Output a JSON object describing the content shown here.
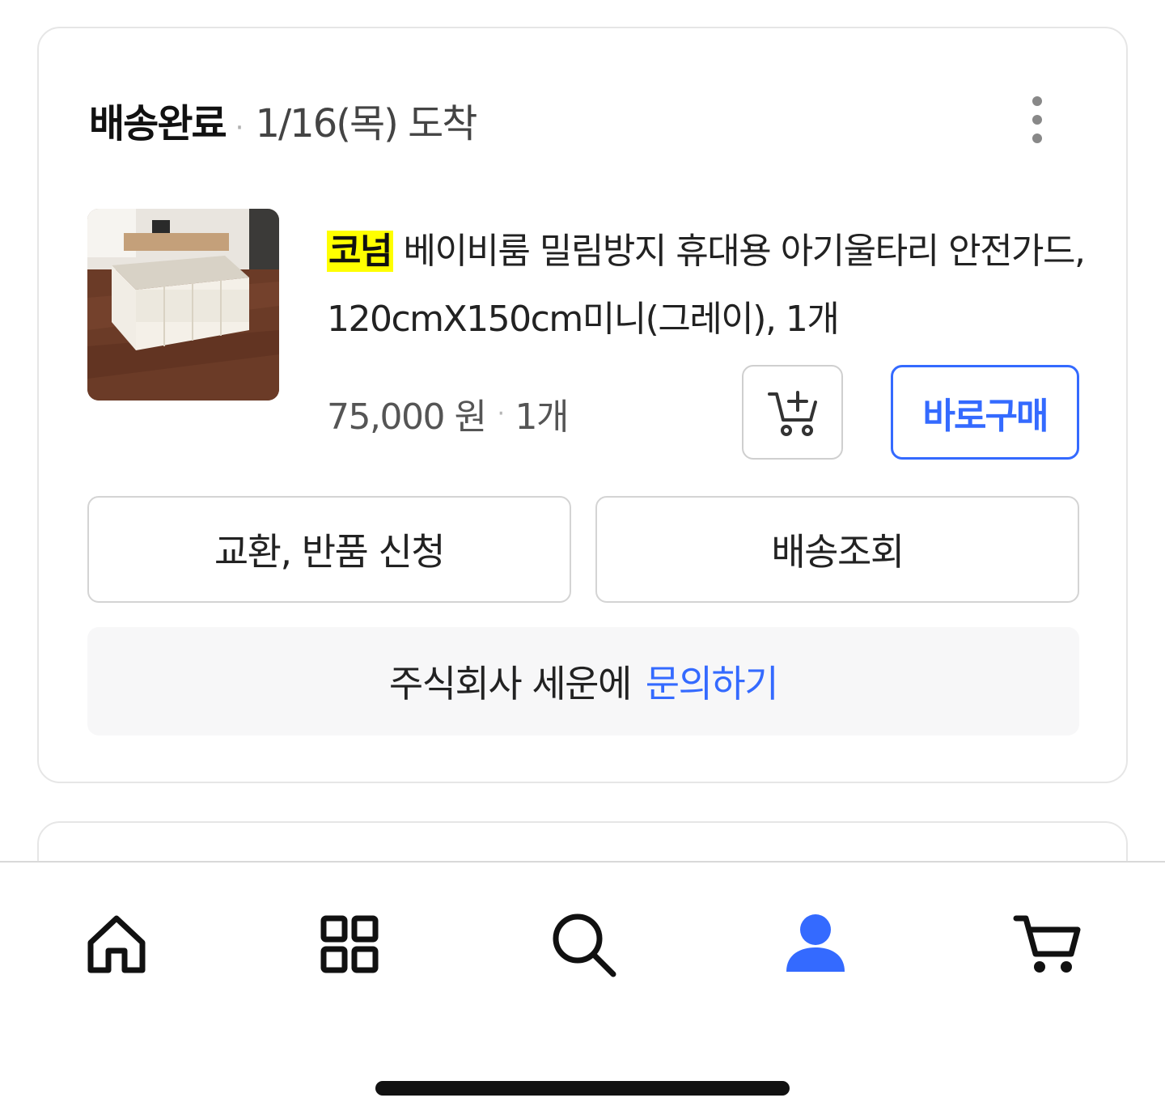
{
  "order": {
    "status": "배송완료",
    "separator": "·",
    "arrival": "1/16(목) 도착",
    "more_icon": "more-vertical-icon"
  },
  "product": {
    "brand": "코넘",
    "title": "베이비룸 밀림방지 휴대용 아기울타리 안전가드, 120cmX150cm미니(그레이), 1개",
    "price": "75,000 원",
    "price_separator": "·",
    "quantity": "1개",
    "image_icon": "baby-playpen-photo"
  },
  "actions": {
    "cart_icon": "cart-plus-icon",
    "buy_now": "바로구매",
    "exchange_return": "교환, 반품 신청",
    "tracking": "배송조회"
  },
  "inquiry": {
    "seller": "주식회사 세운에",
    "link": "문의하기"
  },
  "tab_bar": {
    "items": [
      {
        "icon": "home-icon",
        "active": false
      },
      {
        "icon": "category-grid-icon",
        "active": false
      },
      {
        "icon": "search-icon",
        "active": false
      },
      {
        "icon": "user-icon",
        "active": true
      },
      {
        "icon": "cart-icon",
        "active": false
      }
    ]
  },
  "colors": {
    "accent": "#346aff",
    "highlight": "#ffff00",
    "border": "#e6e6e6"
  }
}
